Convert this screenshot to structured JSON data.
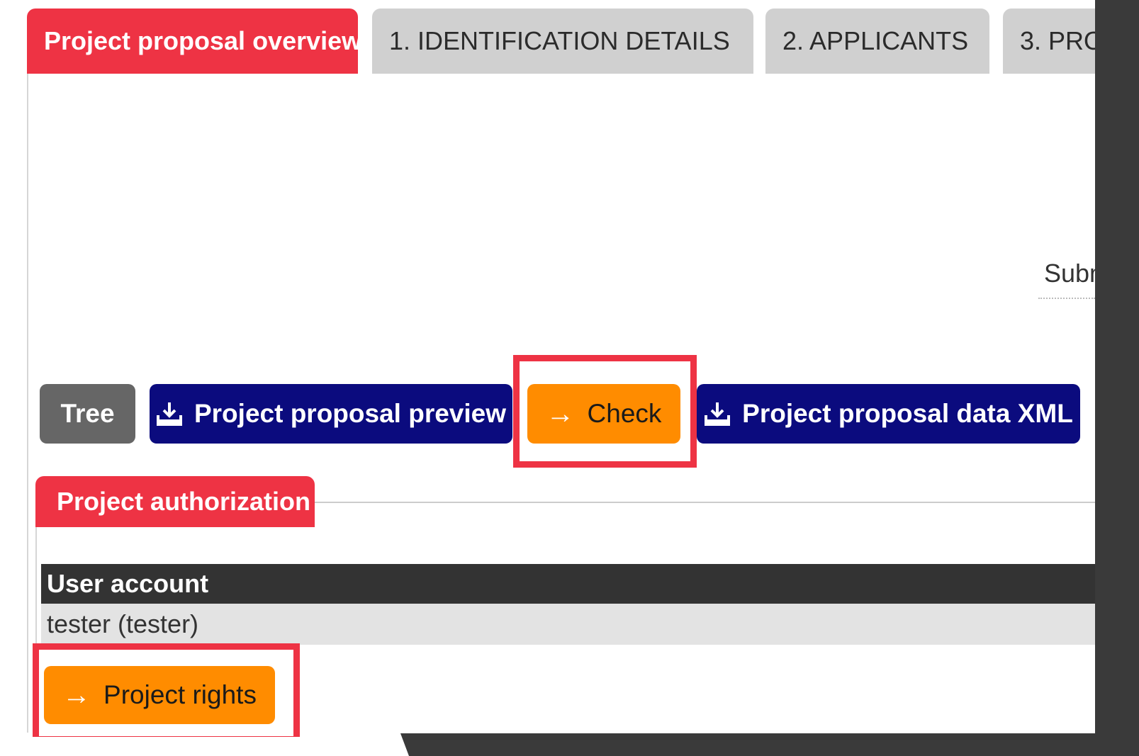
{
  "tabs": [
    {
      "label": "Project proposal overview",
      "active": true
    },
    {
      "label": "1. IDENTIFICATION DETAILS",
      "active": false
    },
    {
      "label": "2. APPLICANTS",
      "active": false
    },
    {
      "label": "3. PRO",
      "active": false
    }
  ],
  "panel": {
    "submit_partial_text": "Subm"
  },
  "toolbar": {
    "tree_label": "Tree",
    "preview_label": "Project proposal preview",
    "check_label": "Check",
    "xml_label": "Project proposal data XML"
  },
  "authorization": {
    "title": "Project authorization",
    "table": {
      "columns": [
        "User account"
      ],
      "rows": [
        [
          "tester (tester)"
        ]
      ]
    },
    "rights_label": "Project rights"
  },
  "icons": {
    "download": "download-icon",
    "arrow": "arrow-right-icon"
  },
  "colors": {
    "accent_red": "#ee3344",
    "navy": "#0b0b7e",
    "orange": "#ff8c00",
    "grey_button": "#666666",
    "header_dark": "#333333"
  }
}
